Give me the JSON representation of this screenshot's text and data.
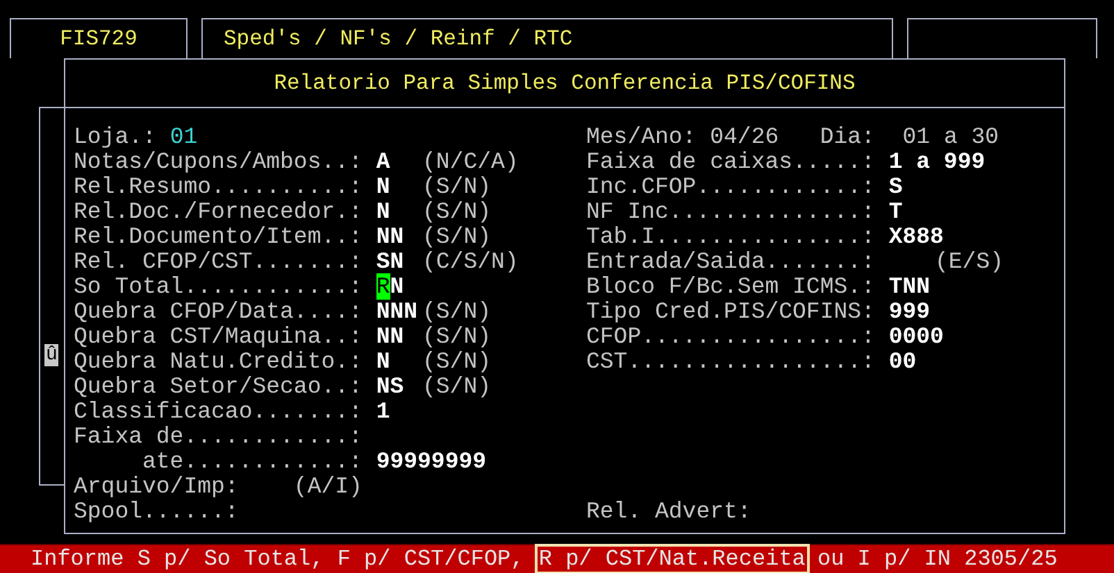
{
  "tabs": [
    {
      "label": "FIS729"
    },
    {
      "label": "Sped's / NF's / Reinf / RTC"
    }
  ],
  "dialog": {
    "title": "Relatorio Para Simples Conferencia PIS/COFINS",
    "scroll_marker": "û",
    "rows": [
      {
        "left": {
          "kind": "inline",
          "label": "Loja.:",
          "value": "01",
          "readonly": true
        },
        "right": {
          "kind": "inline",
          "label": "Mes/Ano:",
          "value": "04/26",
          "extra_label": "Dia:",
          "extra_value": "01 a 30"
        }
      },
      {
        "left": {
          "kind": "aligned",
          "label": "Notas/Cupons/Ambos..:",
          "value": "A",
          "hint": "(N/C/A)",
          "readonly": false
        },
        "right": {
          "kind": "aligned",
          "label": "Faixa de caixas.....:",
          "value": "1 a 999",
          "readonly": false
        }
      },
      {
        "left": {
          "kind": "aligned",
          "label": "Rel.Resumo..........:",
          "value": "N",
          "hint": "(S/N)",
          "readonly": false
        },
        "right": {
          "kind": "aligned",
          "label": "Inc.CFOP............:",
          "value": "S",
          "readonly": false
        }
      },
      {
        "left": {
          "kind": "aligned",
          "label": "Rel.Doc./Fornecedor.:",
          "value": "N",
          "hint": "(S/N)",
          "readonly": false
        },
        "right": {
          "kind": "aligned",
          "label": "NF Inc..............:",
          "value": "T",
          "readonly": false
        }
      },
      {
        "left": {
          "kind": "aligned",
          "label": "Rel.Documento/Item..:",
          "value": "NN",
          "hint": "(S/N)",
          "readonly": false
        },
        "right": {
          "kind": "aligned",
          "label": "Tab.I...............:",
          "value": "X888",
          "readonly": false
        }
      },
      {
        "left": {
          "kind": "aligned",
          "label": "Rel. CFOP/CST.......:",
          "value": "SN",
          "hint": "(C/S/N)",
          "readonly": false
        },
        "right": {
          "kind": "aligned",
          "label": "Entrada/Saida.......:",
          "hint": "(E/S)"
        }
      },
      {
        "left": {
          "kind": "aligned",
          "label": "So Total............:",
          "value": "RN",
          "readonly": false,
          "focused": true
        },
        "right": {
          "kind": "aligned",
          "label": "Bloco F/Bc.Sem ICMS.:",
          "value": "TNN",
          "readonly": false
        }
      },
      {
        "left": {
          "kind": "aligned",
          "label": "Quebra CFOP/Data....:",
          "value": "NNN",
          "hint": "(S/N)",
          "readonly": false
        },
        "right": {
          "kind": "aligned",
          "label": "Tipo Cred.PIS/COFINS:",
          "value": "999",
          "readonly": false
        }
      },
      {
        "left": {
          "kind": "aligned",
          "label": "Quebra CST/Maquina..:",
          "value": "NN",
          "hint": "(S/N)",
          "readonly": false
        },
        "right": {
          "kind": "aligned",
          "label": "CFOP................:",
          "value": "0000",
          "readonly": false
        }
      },
      {
        "left": {
          "kind": "aligned",
          "label": "Quebra Natu.Credito.:",
          "value": "N",
          "hint": "(S/N)",
          "readonly": false
        },
        "right": {
          "kind": "aligned",
          "label": "CST.................:",
          "value": "00",
          "readonly": false
        }
      },
      {
        "left": {
          "kind": "aligned",
          "label": "Quebra Setor/Secao..:",
          "value": "NS",
          "hint": "(S/N)",
          "readonly": false
        }
      },
      {
        "left": {
          "kind": "aligned",
          "label": "Classificacao.......:",
          "value": "1",
          "readonly": false
        }
      },
      {
        "left": {
          "kind": "aligned",
          "label": "Faixa de............:"
        }
      },
      {
        "left": {
          "kind": "sub",
          "label": "ate............:",
          "value": "99999999",
          "readonly": false
        }
      },
      {
        "left": {
          "kind": "inline",
          "label": "Arquivo/Imp:",
          "hint": "(A/I)"
        }
      },
      {
        "left": {
          "kind": "inline",
          "label": "Spool......:"
        },
        "right": {
          "kind": "inline",
          "label": "Rel. Advert:"
        }
      }
    ]
  },
  "status_bar": {
    "segments": [
      {
        "text": "Informe S p/ So Total, F p/ CST/CFOP,",
        "highlighted": false
      },
      {
        "text": "R p/ CST/Nat.Receita",
        "highlighted": true
      },
      {
        "text": "ou I p/ IN 2305/25",
        "highlighted": false
      }
    ]
  }
}
